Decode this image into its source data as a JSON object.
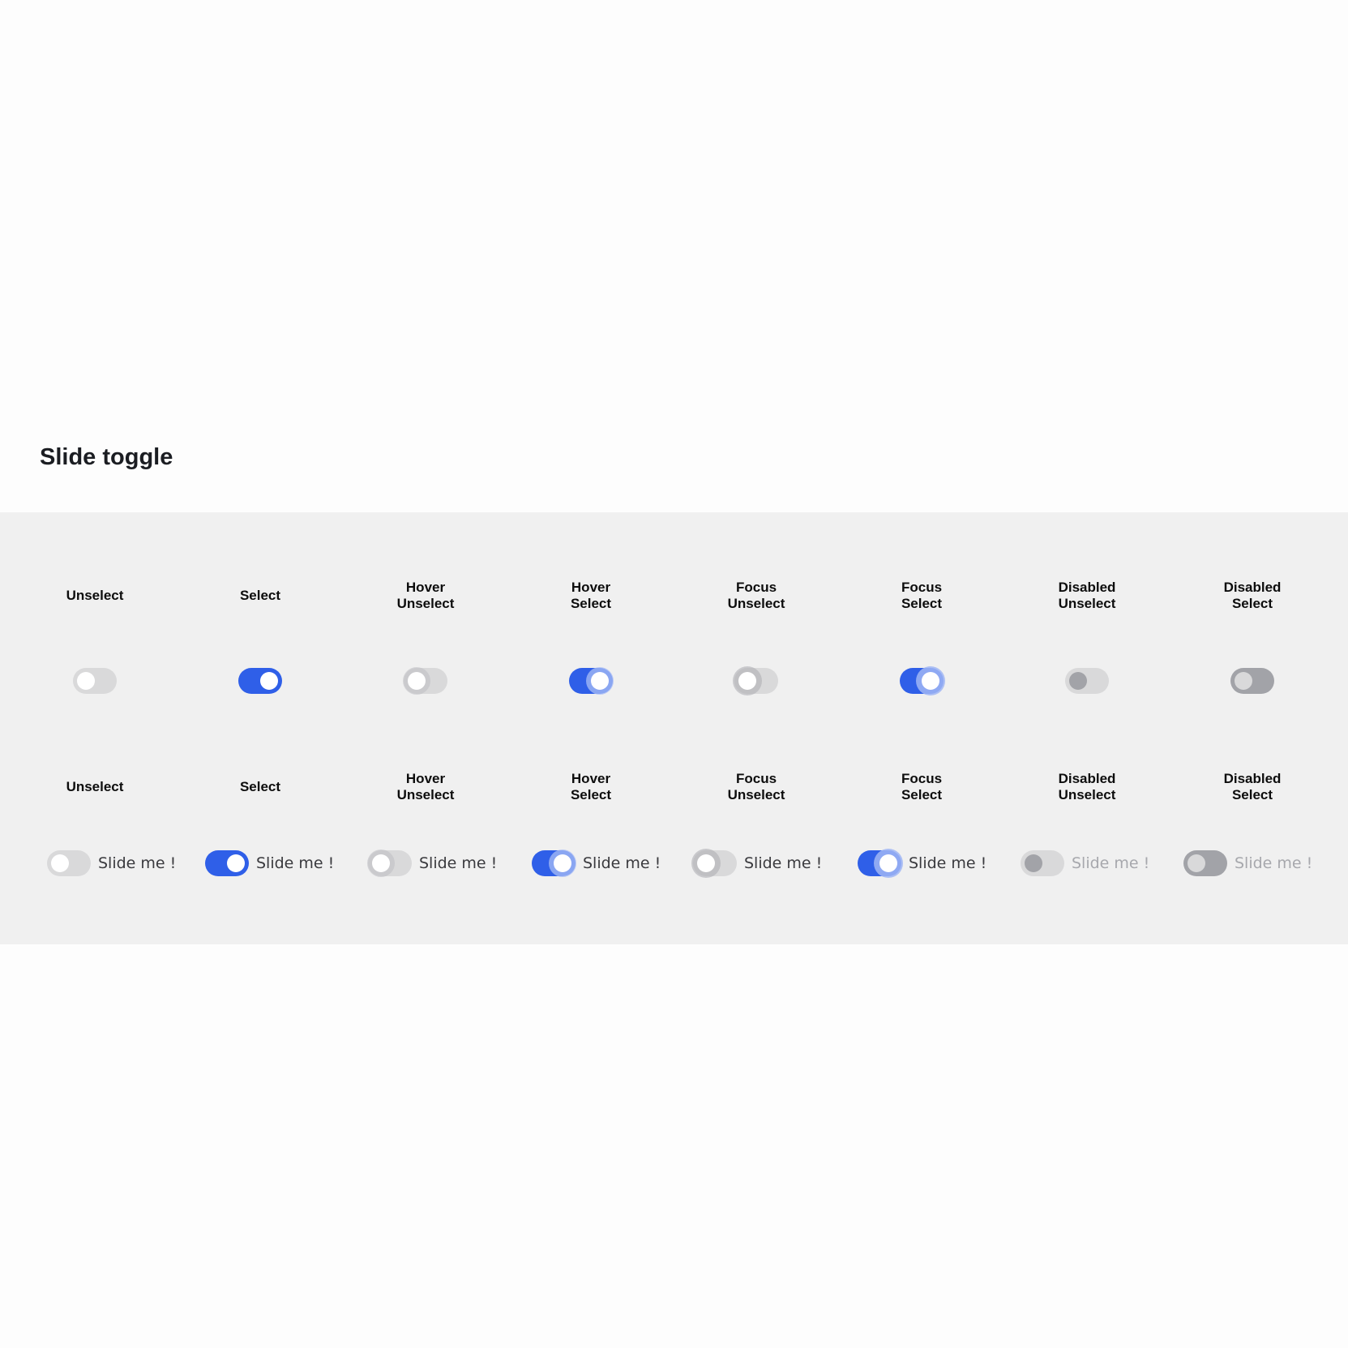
{
  "page": {
    "title": "Slide toggle"
  },
  "row1": {
    "states": [
      {
        "line1": "Unselect",
        "line2": ""
      },
      {
        "line1": "Select",
        "line2": ""
      },
      {
        "line1": "Hover",
        "line2": "Unselect"
      },
      {
        "line1": "Hover",
        "line2": "Select"
      },
      {
        "line1": "Focus",
        "line2": "Unselect"
      },
      {
        "line1": "Focus",
        "line2": "Select"
      },
      {
        "line1": "Disabled",
        "line2": "Unselect"
      },
      {
        "line1": "Disabled",
        "line2": "Select"
      }
    ]
  },
  "row2": {
    "states": [
      {
        "line1": "Unselect",
        "line2": ""
      },
      {
        "line1": "Select",
        "line2": ""
      },
      {
        "line1": "Hover",
        "line2": "Unselect"
      },
      {
        "line1": "Hover",
        "line2": "Select"
      },
      {
        "line1": "Focus",
        "line2": "Unselect"
      },
      {
        "line1": "Focus",
        "line2": "Select"
      },
      {
        "line1": "Disabled",
        "line2": "Unselect"
      },
      {
        "line1": "Disabled",
        "line2": "Select"
      }
    ],
    "captions": [
      "Slide me !",
      "Slide me !",
      "Slide me !",
      "Slide me !",
      "Slide me !",
      "Slide me !",
      "Slide me !",
      "Slide me !"
    ]
  },
  "toggles": [
    {
      "checked": false,
      "state": "default",
      "disabled": false
    },
    {
      "checked": true,
      "state": "default",
      "disabled": false
    },
    {
      "checked": false,
      "state": "hover",
      "disabled": false
    },
    {
      "checked": true,
      "state": "hover",
      "disabled": false
    },
    {
      "checked": false,
      "state": "focus",
      "disabled": false
    },
    {
      "checked": true,
      "state": "focus",
      "disabled": false
    },
    {
      "checked": false,
      "state": "disabled",
      "disabled": true
    },
    {
      "checked": true,
      "state": "disabled",
      "disabled": true
    }
  ],
  "colors": {
    "accent": "#2f5fe8",
    "track_off": "#d9d9da",
    "disabled_gray": "#a2a3a8",
    "panel_bg": "#f0f0f0"
  }
}
